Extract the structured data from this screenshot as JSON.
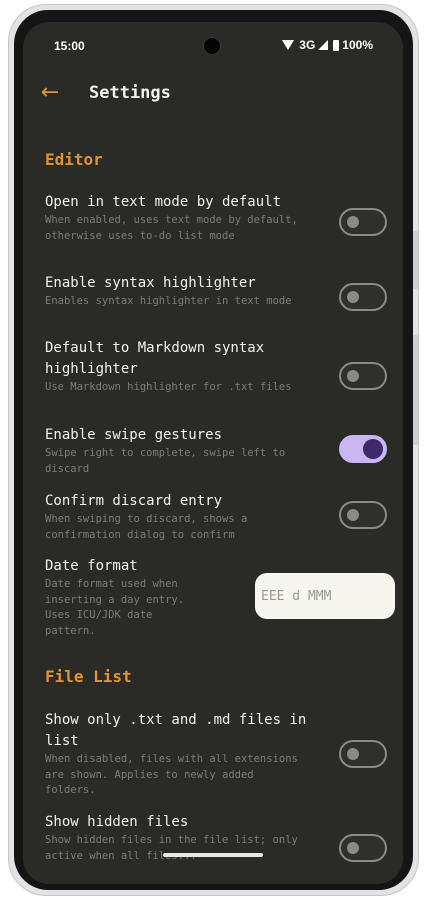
{
  "status_bar": {
    "time": "15:00",
    "network": "3G",
    "battery": "100%"
  },
  "top_bar": {
    "title": "Settings"
  },
  "sections": {
    "editor": {
      "header": "Editor",
      "text_mode": {
        "title": "Open in text mode by default",
        "summary": "When enabled, uses text mode by default, otherwise uses to-do list mode",
        "enabled": false
      },
      "syntax_highlighter": {
        "title": "Enable syntax highlighter",
        "summary": "Enables syntax highlighter in text mode",
        "enabled": false
      },
      "markdown_default": {
        "title": "Default to Markdown syntax highlighter",
        "summary": "Use Markdown highlighter for .txt files",
        "enabled": false
      },
      "swipe_gestures": {
        "title": "Enable swipe gestures",
        "summary": "Swipe right to complete, swipe left to discard",
        "enabled": true
      },
      "confirm_discard": {
        "title": "Confirm discard entry",
        "summary": "When swiping to discard, shows a confirmation dialog to confirm",
        "enabled": false
      },
      "date_format": {
        "title": "Date format",
        "summary": "Date format used when inserting a day entry. Uses ICU/JDK date pattern.",
        "value": "EEE d MMM"
      }
    },
    "file_list": {
      "header": "File List",
      "txt_md_only": {
        "title": "Show only .txt and .md files in list",
        "summary": "When disabled, files with all extensions are shown. Applies to newly added folders.",
        "enabled": false
      },
      "hidden_files": {
        "title": "Show hidden files",
        "summary": "Show hidden files in the file list; only active when all files...",
        "enabled": false
      }
    }
  },
  "colors": {
    "accent": "#e2942f",
    "background": "#2a2a26",
    "switch_on_track": "#c9b6f2",
    "switch_on_thumb": "#3c2a6b"
  }
}
